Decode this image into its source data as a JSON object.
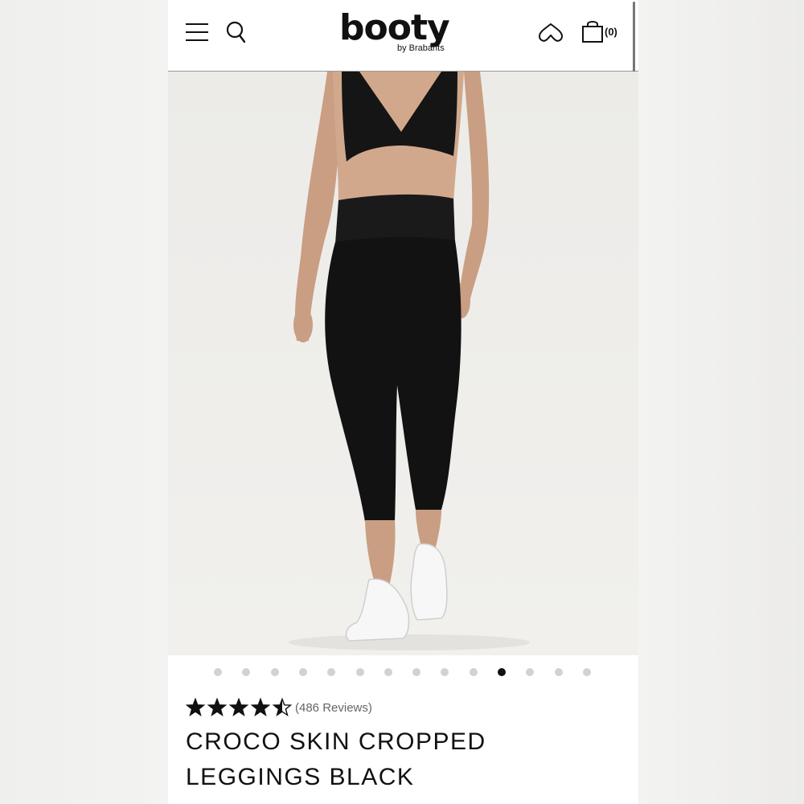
{
  "header": {
    "menu_icon": "hamburger-menu-icon",
    "search_icon": "search-icon",
    "logo_text": "booty",
    "logo_sub": "by Brabants",
    "wishlist_icon": "heart-icon",
    "bag_icon": "shopping-bag-icon",
    "cart_count": "(0)"
  },
  "gallery": {
    "total_images": 14,
    "active_index": 10
  },
  "product": {
    "rating": 4.5,
    "reviews_label": "(486 Reviews)",
    "title_line1": "CROCO SKIN CROPPED",
    "title_line2": "LEGGINGS BLACK"
  },
  "colors": {
    "text": "#111111",
    "dot_inactive": "#d2d2d2",
    "dot_active": "#111111",
    "muted": "#666666"
  }
}
